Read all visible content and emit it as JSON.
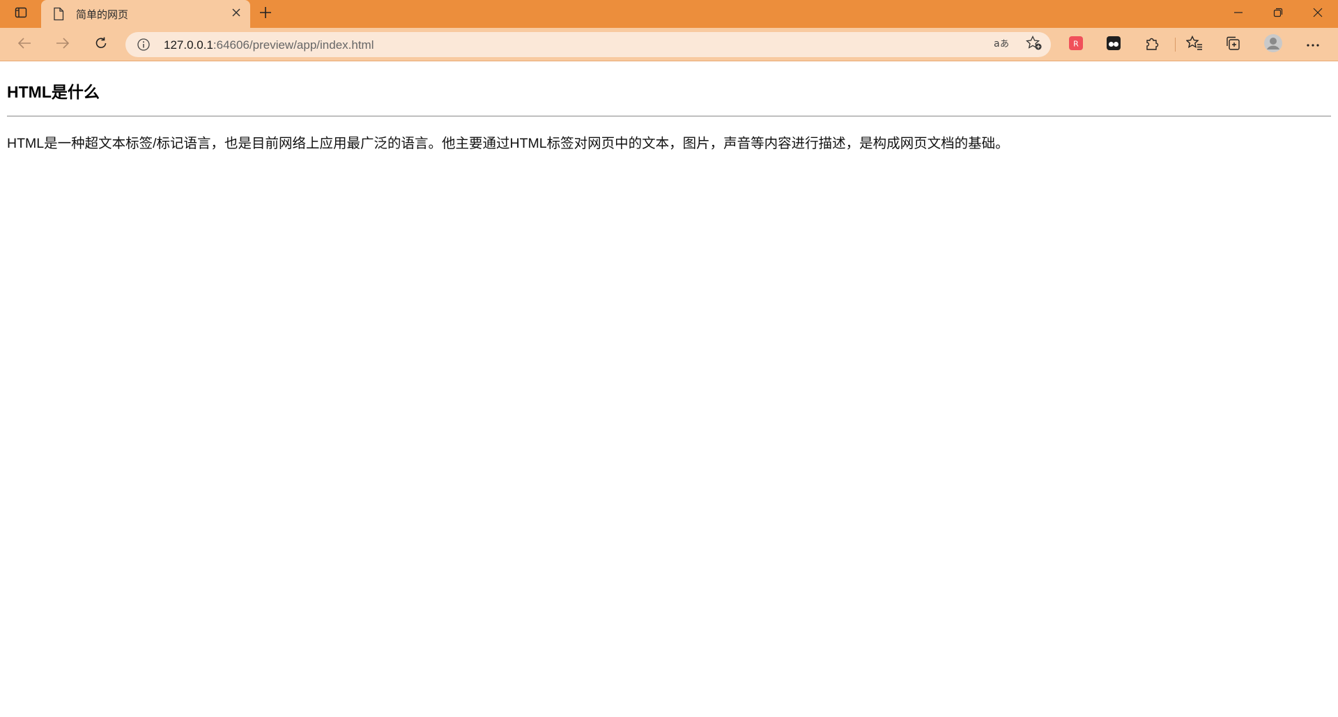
{
  "browser": {
    "tab": {
      "title": "简单的网页"
    },
    "address": {
      "host": "127.0.0.1",
      "rest": ":64606/preview/app/index.html"
    },
    "icons": {
      "tab_actions": "tab-actions-icon",
      "page": "page-icon",
      "close": "close-icon",
      "new_tab": "plus-icon",
      "back": "back-arrow-icon",
      "forward": "forward-arrow-icon",
      "refresh": "refresh-icon",
      "info": "info-icon",
      "read_aloud": "translate-icon",
      "add_favorite": "add-favorite-icon",
      "extension_1": "red-extension-icon",
      "extension_2": "dark-extension-icon",
      "extensions": "puzzle-icon",
      "favorites": "favorites-icon",
      "collections": "collections-icon",
      "profile": "profile-avatar-icon",
      "more": "more-menu-icon"
    },
    "colors": {
      "titlebar": "#ec8e3c",
      "toolbar": "#f8caa0",
      "addressbar": "#fbe8d8"
    }
  },
  "page": {
    "heading": "HTML是什么",
    "paragraph": "HTML是一种超文本标签/标记语言，也是目前网络上应用最广泛的语言。他主要通过HTML标签对网页中的文本，图片，声音等内容进行描述，是构成网页文档的基础。"
  }
}
